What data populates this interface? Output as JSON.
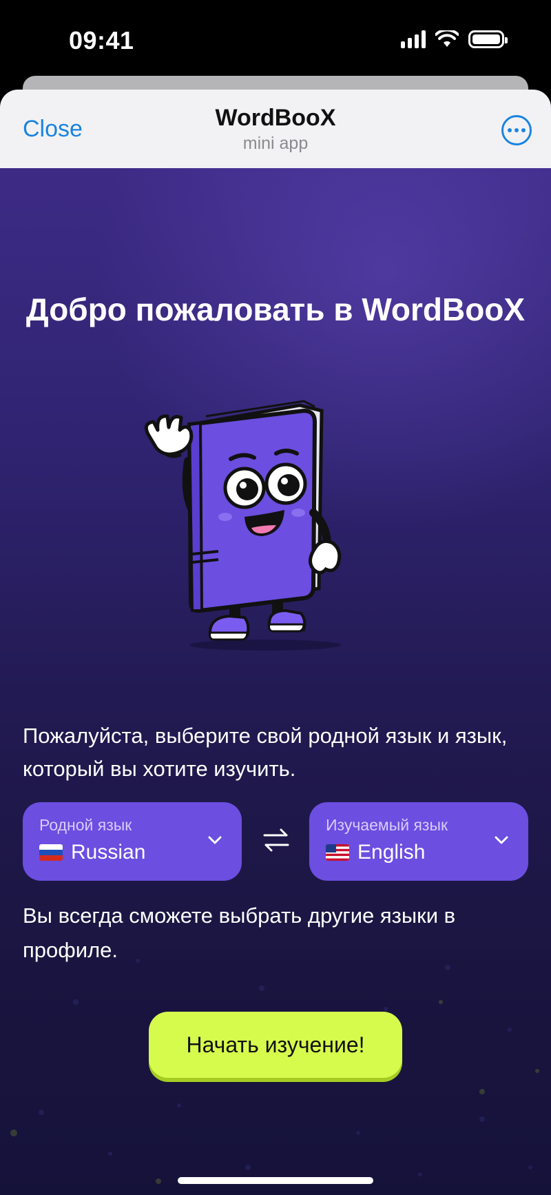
{
  "status_bar": {
    "time": "09:41"
  },
  "nav": {
    "close_label": "Close",
    "title": "WordBooX",
    "subtitle": "mini app"
  },
  "welcome": {
    "title": "Добро пожаловать в WordBooX"
  },
  "intro": {
    "text": "Пожалуйста, выберите свой родной язык и язык, который вы хотите изучить."
  },
  "native_language": {
    "label": "Родной язык",
    "value": "Russian",
    "flag": "ru-flag"
  },
  "target_language": {
    "label": "Изучаемый язык",
    "value": "English",
    "flag": "us-flag"
  },
  "note": {
    "text": "Вы всегда сможете выбрать другие языки в профиле."
  },
  "start_button": {
    "label": "Начать изучение!"
  },
  "colors": {
    "accent_purple": "#6c4ee0",
    "cta_lime": "#d7fb4d",
    "link_blue": "#1a84e0",
    "bg_top": "#3d2b86",
    "bg_bottom": "#15123a"
  },
  "icons": [
    "signal-icon",
    "wifi-icon",
    "battery-icon",
    "more-icon",
    "chevron-down-icon",
    "swap-icon",
    "book-mascot"
  ]
}
